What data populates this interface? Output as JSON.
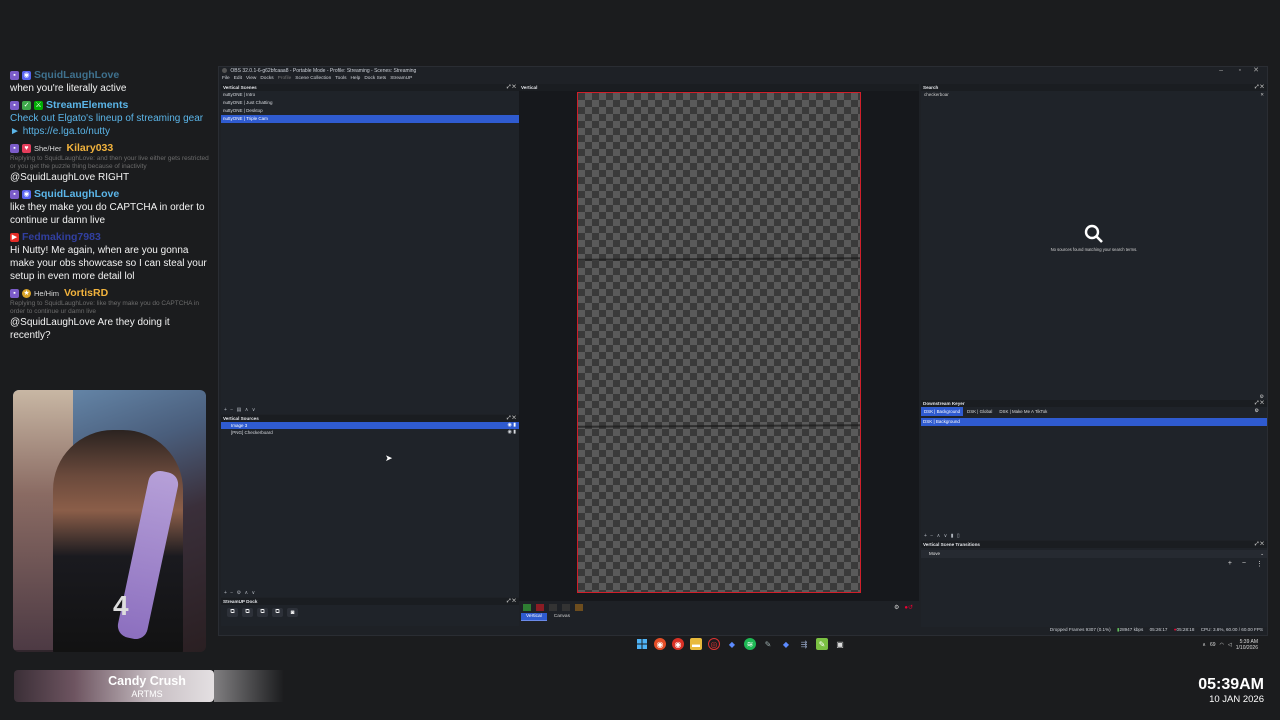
{
  "chat": [
    {
      "user": "SquidLaughLove",
      "color": "#5bb5e8",
      "badges": [
        "twitch",
        "discord"
      ],
      "text": "when you're literally active",
      "faded_name": true
    },
    {
      "user": "StreamElements",
      "color": "#5bb5e8",
      "badges": [
        "twitch",
        "green",
        "mod"
      ],
      "text_parts": [
        "Check out Elgato's lineup of streaming gear ► ",
        "https://e.lga.to/nutty"
      ]
    },
    {
      "user": "Kilary033",
      "color": "#f2b33d",
      "pronoun": "She/Her",
      "badges": [
        "twitch",
        "heart"
      ],
      "reply": "Replying to SquidLaughLove: and then your live either gets restricted or you get the puzzle thing because of inactivity",
      "text": "@SquidLaughLove RIGHT"
    },
    {
      "user": "SquidLaughLove",
      "color": "#5bb5e8",
      "badges": [
        "twitch",
        "discord"
      ],
      "text": "like they make you do CAPTCHA in order to continue ur damn live"
    },
    {
      "user": "Fedmaking7983",
      "color": "#3b4fd8",
      "badges": [
        "youtube"
      ],
      "text": "Hi Nutty! Me again, when are you gonna make your obs showcase so I can steal your setup in even more detail lol",
      "faded_name": true
    },
    {
      "user": "VortisRD",
      "color": "#f2b33d",
      "pronoun": "He/Him",
      "badges": [
        "twitch",
        "sub"
      ],
      "reply": "Replying to SquidLaughLove: like they make you do CAPTCHA in order to continue ur damn live",
      "text": "@SquidLaughLove Are they doing it recently?"
    }
  ],
  "music": {
    "song": "Candy Crush",
    "artist": "ARTMS"
  },
  "clock": {
    "time": "05:39AM",
    "date": "10 JAN 2026"
  },
  "obs": {
    "title": "OBS 32.0.1-6-g62bfcaaa8 - Portable Mode - Profile: Streaming - Scenes: Streaming",
    "menu": [
      "File",
      "Edit",
      "View",
      "Docks",
      "Profile",
      "Scene Collection",
      "Tools",
      "Help",
      "Dock Sets",
      "StreamUP"
    ],
    "scenes_dock": {
      "title": "Vertical Scenes",
      "items": [
        "nuttyONE | Intro",
        "nuttyONE | Just Chatting",
        "nuttyONE | Desktop",
        "nuttyONE | Triple Cam"
      ],
      "selected": 3
    },
    "sources_dock": {
      "title": "Vertical Sources",
      "items": [
        "Image 3",
        "[PNG] Checkerboard"
      ],
      "selected": 0
    },
    "streamup_dock": {
      "title": "StreamUP Dock"
    },
    "preview_title": "Vertical",
    "preview_tabs": [
      "Vertical",
      "Canvas"
    ],
    "search_dock": {
      "title": "Search",
      "query": "checkerboar",
      "empty": "No sources found matching your search terms."
    },
    "dsk_dock": {
      "title": "Downstream Keyer",
      "tabs": [
        "DSK | Background",
        "DSK | Global",
        "DSK | Make Me A TikTok"
      ],
      "items": [
        "DSK | Background"
      ]
    },
    "transitions_dock": {
      "title": "Vertical Scene Transitions",
      "selected": "Move"
    },
    "status": {
      "dropped": "Dropped Frames 9307 (0.1%)",
      "kbps": "28947 kbps",
      "rec_time": "05:26:17",
      "stream_time": "05:28:18",
      "cpu": "CPU: 3.6%, 60.00 / 60.00 FPS"
    }
  },
  "tray": {
    "time": "5:39 AM",
    "date": "1/10/2026",
    "battery": "69"
  }
}
